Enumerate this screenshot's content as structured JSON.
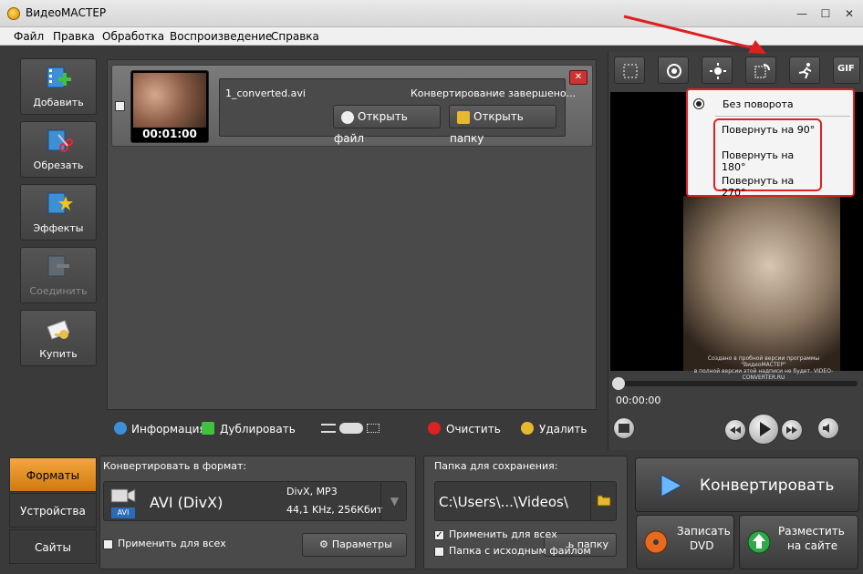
{
  "window": {
    "title": "ВидеоМАСТЕР",
    "minimize": "—",
    "maximize": "☐",
    "close": "✕"
  },
  "menu": [
    "Файл",
    "Правка",
    "Обработка",
    "Воспроизведение",
    "Справка"
  ],
  "left_toolbar": [
    {
      "label": "Добавить",
      "icon": "add-film-icon"
    },
    {
      "label": "Обрезать",
      "icon": "cut-film-icon"
    },
    {
      "label": "Эффекты",
      "icon": "effects-icon"
    },
    {
      "label": "Соединить",
      "icon": "join-icon"
    },
    {
      "label": "Купить",
      "icon": "buy-key-icon"
    }
  ],
  "file_item": {
    "name": "1_converted.avi",
    "duration": "00:01:00",
    "status": "Конвертирование завершено...",
    "open_file": "Открыть файл",
    "open_folder": "Открыть папку",
    "close": "✕"
  },
  "list_bar": {
    "info": "Информация",
    "duplicate": "Дублировать",
    "clear": "Очистить",
    "delete": "Удалить"
  },
  "preview_tools": [
    "crop-icon",
    "stabilize-icon",
    "brightness-icon",
    "rotate-icon",
    "speed-icon",
    "gif-icon"
  ],
  "gif_label": "GIF",
  "rotate_menu": {
    "options": [
      "Без поворота",
      "Повернуть на 90°",
      "Повернуть на 180°",
      "Повернуть на 270°"
    ],
    "selected": "Без поворота"
  },
  "watermark": [
    "Создано в пробной версии программы \"ВидеоМАСТЕР\"",
    "в полной версии этой надписи не будет. VIDEO-CONVERTER.RU"
  ],
  "player": {
    "time": "00:00:00",
    "progress": 0
  },
  "tabs": [
    "Форматы",
    "Устройства",
    "Сайты"
  ],
  "active_tab": "Форматы",
  "format": {
    "heading": "Конвертировать в формат:",
    "name": "AVI (DivX)",
    "badge": "AVI",
    "codecs": "DivX, MP3",
    "audio": "44,1 KHz, 256Кбит",
    "apply_all": "Применить для всех",
    "params": "Параметры"
  },
  "save": {
    "heading": "Папка для сохранения:",
    "path": "C:\\Users\\...\\Videos\\",
    "apply_all": "Применить для всех",
    "apply_all_checked": true,
    "source_folder": "Папка с исходным файлом",
    "open_folder_partial": "ь папку"
  },
  "actions": {
    "convert": "Конвертировать",
    "dvd_line1": "Записать",
    "dvd_line2": "DVD",
    "upload_line1": "Разместить",
    "upload_line2": "на сайте"
  }
}
